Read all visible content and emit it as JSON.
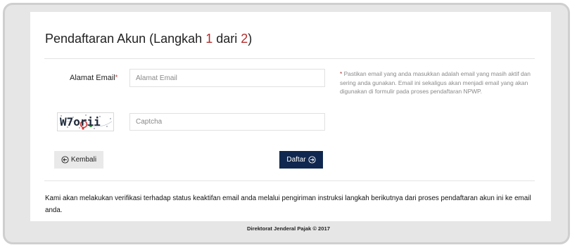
{
  "page": {
    "title_prefix": "Pendaftaran Akun  (Langkah ",
    "step_current": "1",
    "title_middle": " dari ",
    "step_total": "2",
    "title_suffix": ")"
  },
  "form": {
    "email_label": "Alamat Email",
    "email_required_mark": "*",
    "email_placeholder": "Alamat Email",
    "email_value": "",
    "captcha_image_text": "W7orii",
    "captcha_placeholder": "Captcha",
    "captcha_value": "",
    "help_star": "*",
    "help_text": " Pastikan email yang anda masukkan adalah email yang masih aktif dan sering anda gunakan. Email ini sekaligus akan menjadi email yang akan digunakan di formulir pada proses pendaftaran NPWP."
  },
  "buttons": {
    "back_label": "Kembali",
    "back_icon": "arrow-left-circle-icon",
    "register_label": "Daftar",
    "register_icon": "arrow-right-circle-icon"
  },
  "note": "Kami akan melakukan verifikasi terhadap status keaktifan email anda melalui pengiriman instruksi langkah berikutnya dari proses pendaftaran akun ini ke email anda.",
  "footer": "Direktorat Jenderal Pajak © 2017",
  "colors": {
    "accent_red": "#b32d2d",
    "primary_button": "#10284f",
    "page_background": "#e6e6e6"
  }
}
